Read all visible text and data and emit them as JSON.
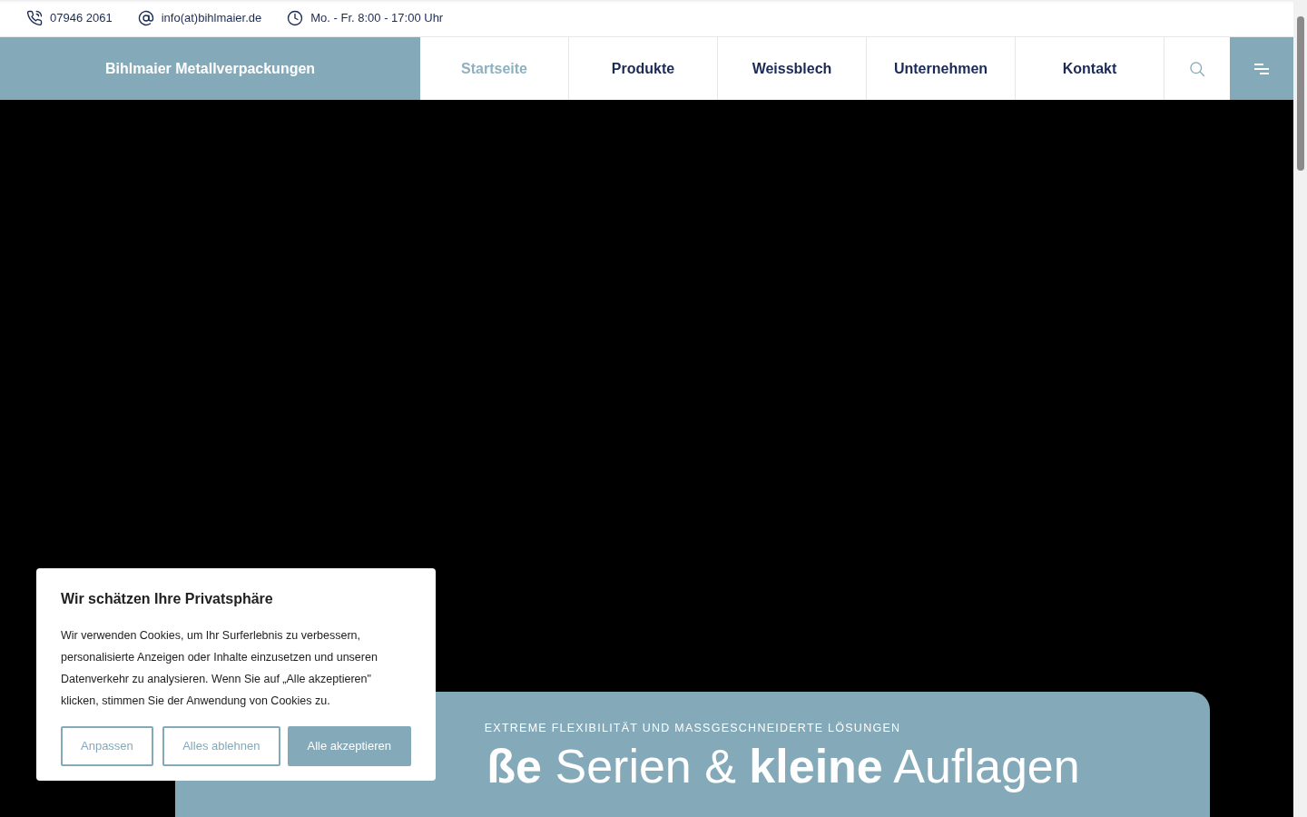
{
  "top_bar": {
    "contacts": [
      {
        "kind": "phone",
        "text": "07946 2061"
      },
      {
        "kind": "email",
        "text": "info(at)bihlmaier.de"
      },
      {
        "kind": "hours",
        "text": "Mo. - Fr. 8:00 - 17:00 Uhr"
      }
    ]
  },
  "header": {
    "logo": "Bihlmaier Metallverpackungen",
    "nav": [
      {
        "label": "Startseite",
        "selected": true
      },
      {
        "label": "Produkte",
        "selected": false
      },
      {
        "label": "Weissblech",
        "selected": false
      },
      {
        "label": "Unternehmen",
        "selected": false
      },
      {
        "label": "Kontakt",
        "selected": false
      }
    ]
  },
  "hero": {
    "kicker": "EXTREME FLEXIBILITÄT UND MASSGESCHNEIDERTE LÖSUNGEN",
    "headline": "**ße** Serien & **kleine** Auflagen"
  },
  "cookie_banner": {
    "title": "Wir schätzen Ihre Privatsphäre",
    "text": "Wir verwenden Cookies, um Ihr Surferlebnis zu verbessern, personalisierte Anzeigen oder Inhalte einzusetzen und unseren Datenverkehr zu analysieren. Wenn Sie auf „Alle akzeptieren\" klicken, stimmen Sie der Anwendung von Cookies zu.",
    "buttons": [
      {
        "label": "Anpassen",
        "kind": "outline"
      },
      {
        "label": "Alles ablehnen",
        "kind": "outline"
      },
      {
        "label": "Alle akzeptieren",
        "kind": "primary"
      }
    ]
  }
}
